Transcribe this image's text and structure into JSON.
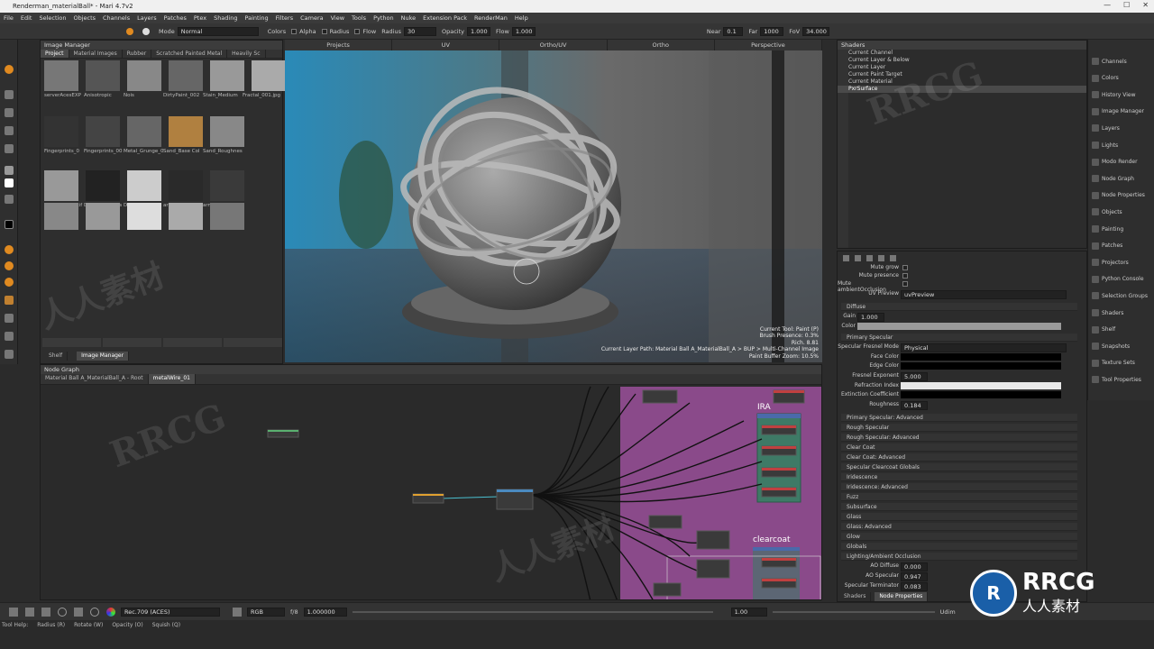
{
  "window": {
    "title": "Renderman_materialBall* - Mari 4.7v2",
    "controls": [
      "—",
      "☐",
      "✕"
    ]
  },
  "menu": [
    "File",
    "Edit",
    "Selection",
    "Objects",
    "Channels",
    "Layers",
    "Patches",
    "Ptex",
    "Shading",
    "Painting",
    "Filters",
    "Camera",
    "View",
    "Tools",
    "Python",
    "Nuke",
    "Extension Pack",
    "RenderMan",
    "Help"
  ],
  "toolbar": {
    "mode_label": "Mode",
    "mode_value": "Normal",
    "colors_label": "Colors",
    "alpha_label": "Alpha",
    "radius_label": "Radius",
    "flow_label": "Flow",
    "radius_field_label": "Radius",
    "radius_value": "30",
    "opacity_label": "Opacity",
    "opacity_value": "1.000",
    "flow_field_label": "Flow",
    "flow_value": "1.000",
    "near_label": "Near",
    "near_value": "0.1",
    "far_label": "Far",
    "far_value": "1000",
    "fov_label": "FoV",
    "fov_value": "34.000"
  },
  "image_manager": {
    "title": "Image Manager",
    "tabs": [
      "Project",
      "Material Images",
      "Rubber",
      "Scratched Painted Metal",
      "Heavily Sc"
    ],
    "row_labels": [
      [
        "serverAcesEXP",
        "Anisotropic",
        "Nois",
        "DirtyPaint_002",
        "Stain_Medium",
        "Fractal_001.jpg"
      ],
      [
        "Fingerprints_0",
        "Fingerprints_00",
        "Metal_Grunge_0",
        "Sand_Base Col",
        "Sand_Roughnes"
      ],
      [
        "Sand_Height.tif",
        "Dirt_SpotsDens",
        "DirtyPaint_001",
        "armymaterial_f",
        "armymaterial_f"
      ]
    ],
    "footer_tabs": [
      "Shelf",
      "Image Manager"
    ]
  },
  "viewport": {
    "tabs": [
      "Projects",
      "UV",
      "Ortho/UV",
      "Ortho",
      "Perspective"
    ],
    "info": [
      "Current Tool: Paint (P)",
      "Brush Presence: 0.3%",
      "Rich. 8.81",
      "Current Layer Path: Material Ball A_MaterialBall_A > BUP > Multi-Channel Image",
      "",
      "Paint Buffer Zoom: 10.5%"
    ]
  },
  "node_graph": {
    "title": "Node Graph",
    "tabs": [
      "Material Ball A_MaterialBall_A - Root",
      "metalWire_01"
    ],
    "group_labels": [
      "IRA",
      "clearcoat"
    ]
  },
  "shaders": {
    "title": "Shaders",
    "items": [
      "Current Channel",
      "Current Layer & Below",
      "Current Layer",
      "Current Paint Target",
      "Current Material",
      "PxrSurface"
    ]
  },
  "properties": {
    "rows_top": [
      {
        "label": "Mute grow"
      },
      {
        "label": "Mute presence"
      },
      {
        "label": "Mute ambientOcclusion"
      }
    ],
    "uv_preview_label": "UV Preview",
    "uv_preview_value": "uvPreview",
    "diffuse_section": "Diffuse",
    "gain_label": "Gain",
    "gain_value": "1.000",
    "color_label": "Color",
    "primary_specular_section": "Primary Specular",
    "fresnel_mode_label": "Specular Fresnel Mode",
    "fresnel_mode_value": "Physical",
    "face_color_label": "Face Color",
    "edge_color_label": "Edge Color",
    "fresnel_exp_label": "Fresnel Exponent",
    "fresnel_exp_value": "5.000",
    "refraction_label": "Refraction Index",
    "extinction_label": "Extinction Coefficient",
    "roughness_label": "Roughness",
    "roughness_value": "0.184",
    "sections": [
      "Primary Specular: Advanced",
      "Rough Specular",
      "Rough Specular: Advanced",
      "Clear Coat",
      "Clear Coat: Advanced",
      "Specular Clearcoat Globals",
      "Iridescence",
      "Iridescence: Advanced",
      "Fuzz",
      "Subsurface",
      "Glass",
      "Glass: Advanced",
      "Glow",
      "Globals",
      "Lighting/Ambient Occlusion"
    ],
    "ao_diffuse_label": "AO Diffuse",
    "ao_diffuse_value": "0.000",
    "ao_specular_label": "AO Specular",
    "ao_specular_value": "0.947",
    "spec_term_label": "Specular Terminator",
    "spec_term_value": "0.083",
    "footer_tabs": [
      "Shaders",
      "Node Properties"
    ]
  },
  "right_panel": [
    "Channels",
    "Colors",
    "History View",
    "Image Manager",
    "Layers",
    "Lights",
    "Modo Render",
    "Node Graph",
    "Node Properties",
    "Objects",
    "Painting",
    "Patches",
    "Projectors",
    "Python Console",
    "Selection Groups",
    "Shaders",
    "Shelf",
    "Snapshots",
    "Texture Sets",
    "Tool Properties"
  ],
  "bottom": {
    "colorspace": "Rec.709 (ACES)",
    "channel": "RGB",
    "fstop": "f/8",
    "exposure": "1.000000",
    "gain": "1.00",
    "udim": "Udim"
  },
  "status": {
    "tool_help": "Tool Help:",
    "radius": "Radius (R)",
    "rotate": "Rotate (W)",
    "opacity": "Opacity (O)",
    "squish": "Squish (Q)"
  },
  "watermarks": [
    "RRCG",
    "人人素材",
    "RRCG",
    "人人素材"
  ],
  "brand": {
    "logo_text": "RRCG",
    "logo_sub": "人人素材"
  }
}
